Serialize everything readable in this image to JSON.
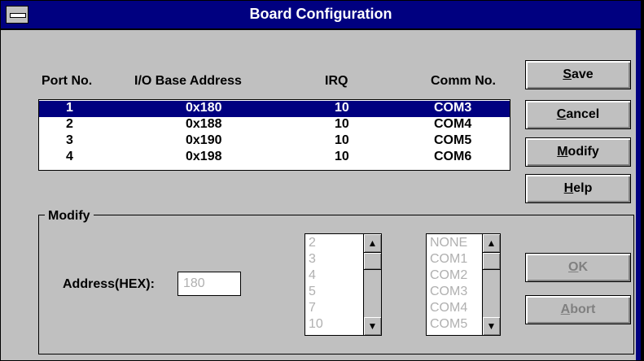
{
  "window": {
    "title": "Board Configuration"
  },
  "headers": {
    "port": "Port No.",
    "address": "I/O Base Address",
    "irq": "IRQ",
    "comm": "Comm No."
  },
  "rows": [
    {
      "port": "1",
      "address": "0x180",
      "irq": "10",
      "comm": "COM3"
    },
    {
      "port": "2",
      "address": "0x188",
      "irq": "10",
      "comm": "COM4"
    },
    {
      "port": "3",
      "address": "0x190",
      "irq": "10",
      "comm": "COM5"
    },
    {
      "port": "4",
      "address": "0x198",
      "irq": "10",
      "comm": "COM6"
    }
  ],
  "buttons": {
    "save": {
      "mn": "S",
      "rest": "ave"
    },
    "cancel": {
      "mn": "C",
      "rest": "ancel"
    },
    "modify": {
      "mn": "M",
      "rest": "odify"
    },
    "help": {
      "mn": "H",
      "rest": "elp"
    },
    "ok": {
      "mn": "O",
      "rest": "K"
    },
    "abort": {
      "mn": "A",
      "rest": "bort"
    }
  },
  "modify_group": {
    "label": "Modify",
    "address_label": "Address(HEX):",
    "address_value": "180",
    "irq_options": [
      "2",
      "3",
      "4",
      "5",
      "7",
      "10"
    ],
    "com_options": [
      "NONE",
      "COM1",
      "COM2",
      "COM3",
      "COM4",
      "COM5"
    ]
  },
  "icons": {
    "sys": "system-menu-icon",
    "up": "scroll-up-arrow-icon",
    "down": "scroll-down-arrow-icon"
  }
}
